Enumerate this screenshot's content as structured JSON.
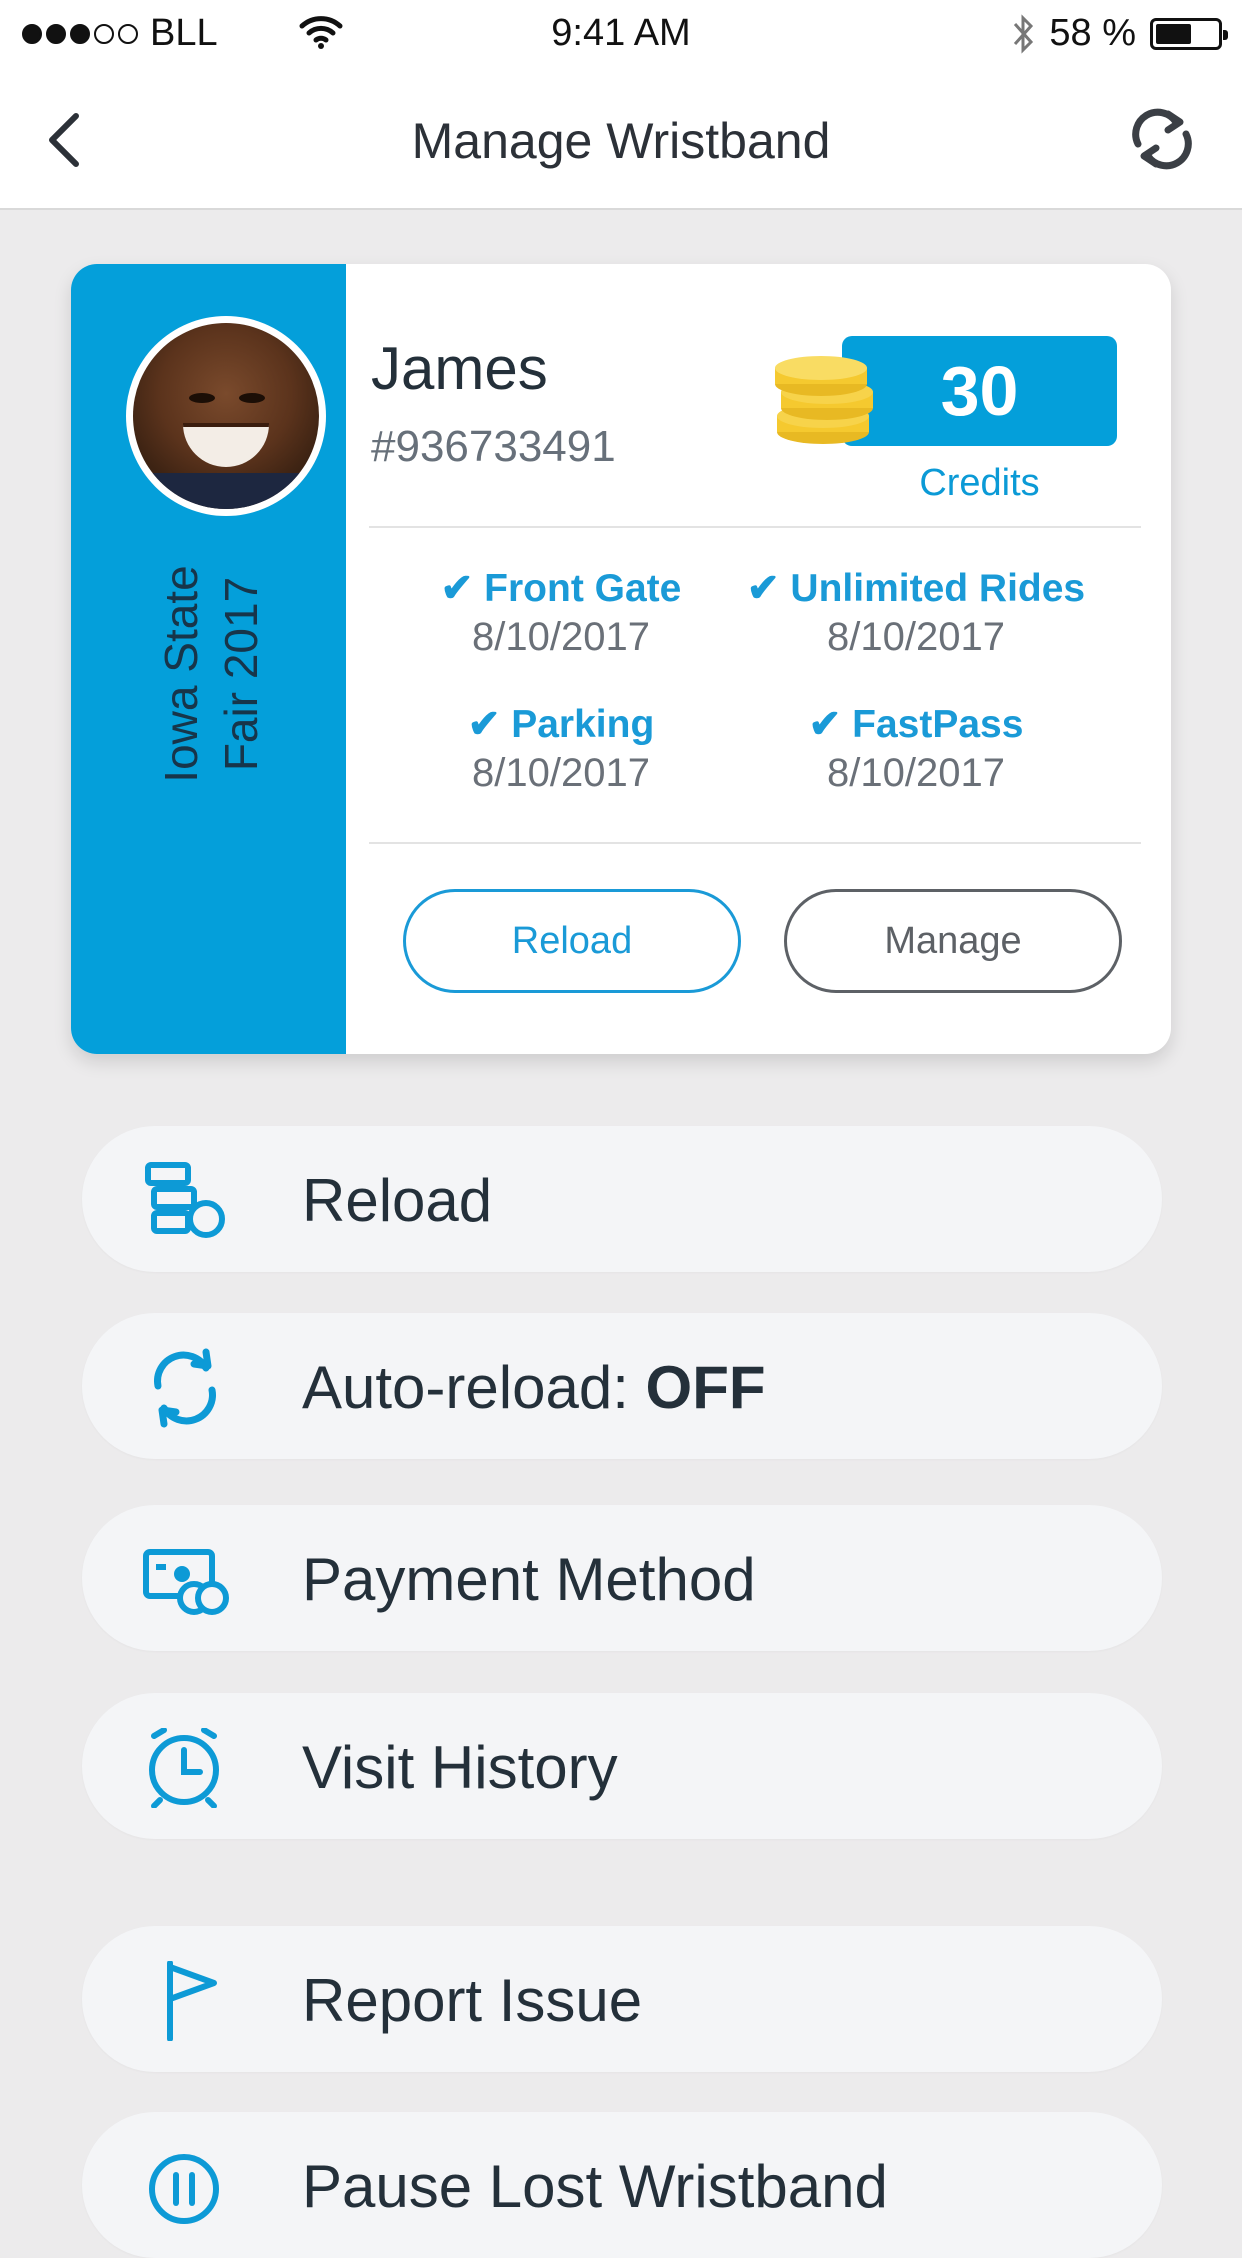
{
  "status_bar": {
    "carrier": "BLL",
    "time": "9:41 AM",
    "battery": "58 %",
    "battery_level": 0.58
  },
  "nav": {
    "title": "Manage Wristband",
    "back_icon": "chevron-left-icon",
    "sync_icon": "sync-icon"
  },
  "wristband": {
    "event_line1": "Iowa State",
    "event_line2": "Fair 2017",
    "name": "James",
    "account": "#936733491",
    "credits_value": "30",
    "credits_label": "Credits",
    "passes": [
      {
        "name": "Front Gate",
        "date": "8/10/2017"
      },
      {
        "name": "Unlimited Rides",
        "date": "8/10/2017"
      },
      {
        "name": "Parking",
        "date": "8/10/2017"
      },
      {
        "name": "FastPass",
        "date": "8/10/2017"
      }
    ],
    "check_mark": "✔",
    "reload_button": "Reload",
    "manage_button": "Manage"
  },
  "menu": {
    "reload": "Reload",
    "auto_reload_prefix": "Auto-reload: ",
    "auto_reload_state": "OFF",
    "payment": "Payment Method",
    "visit_history": "Visit History",
    "report_issue": "Report Issue",
    "pause_lost": "Pause Lost Wristband"
  },
  "colors": {
    "accent": "#049fda",
    "background": "#ecebec",
    "item_bg": "#f4f5f7",
    "text": "#24303a"
  }
}
